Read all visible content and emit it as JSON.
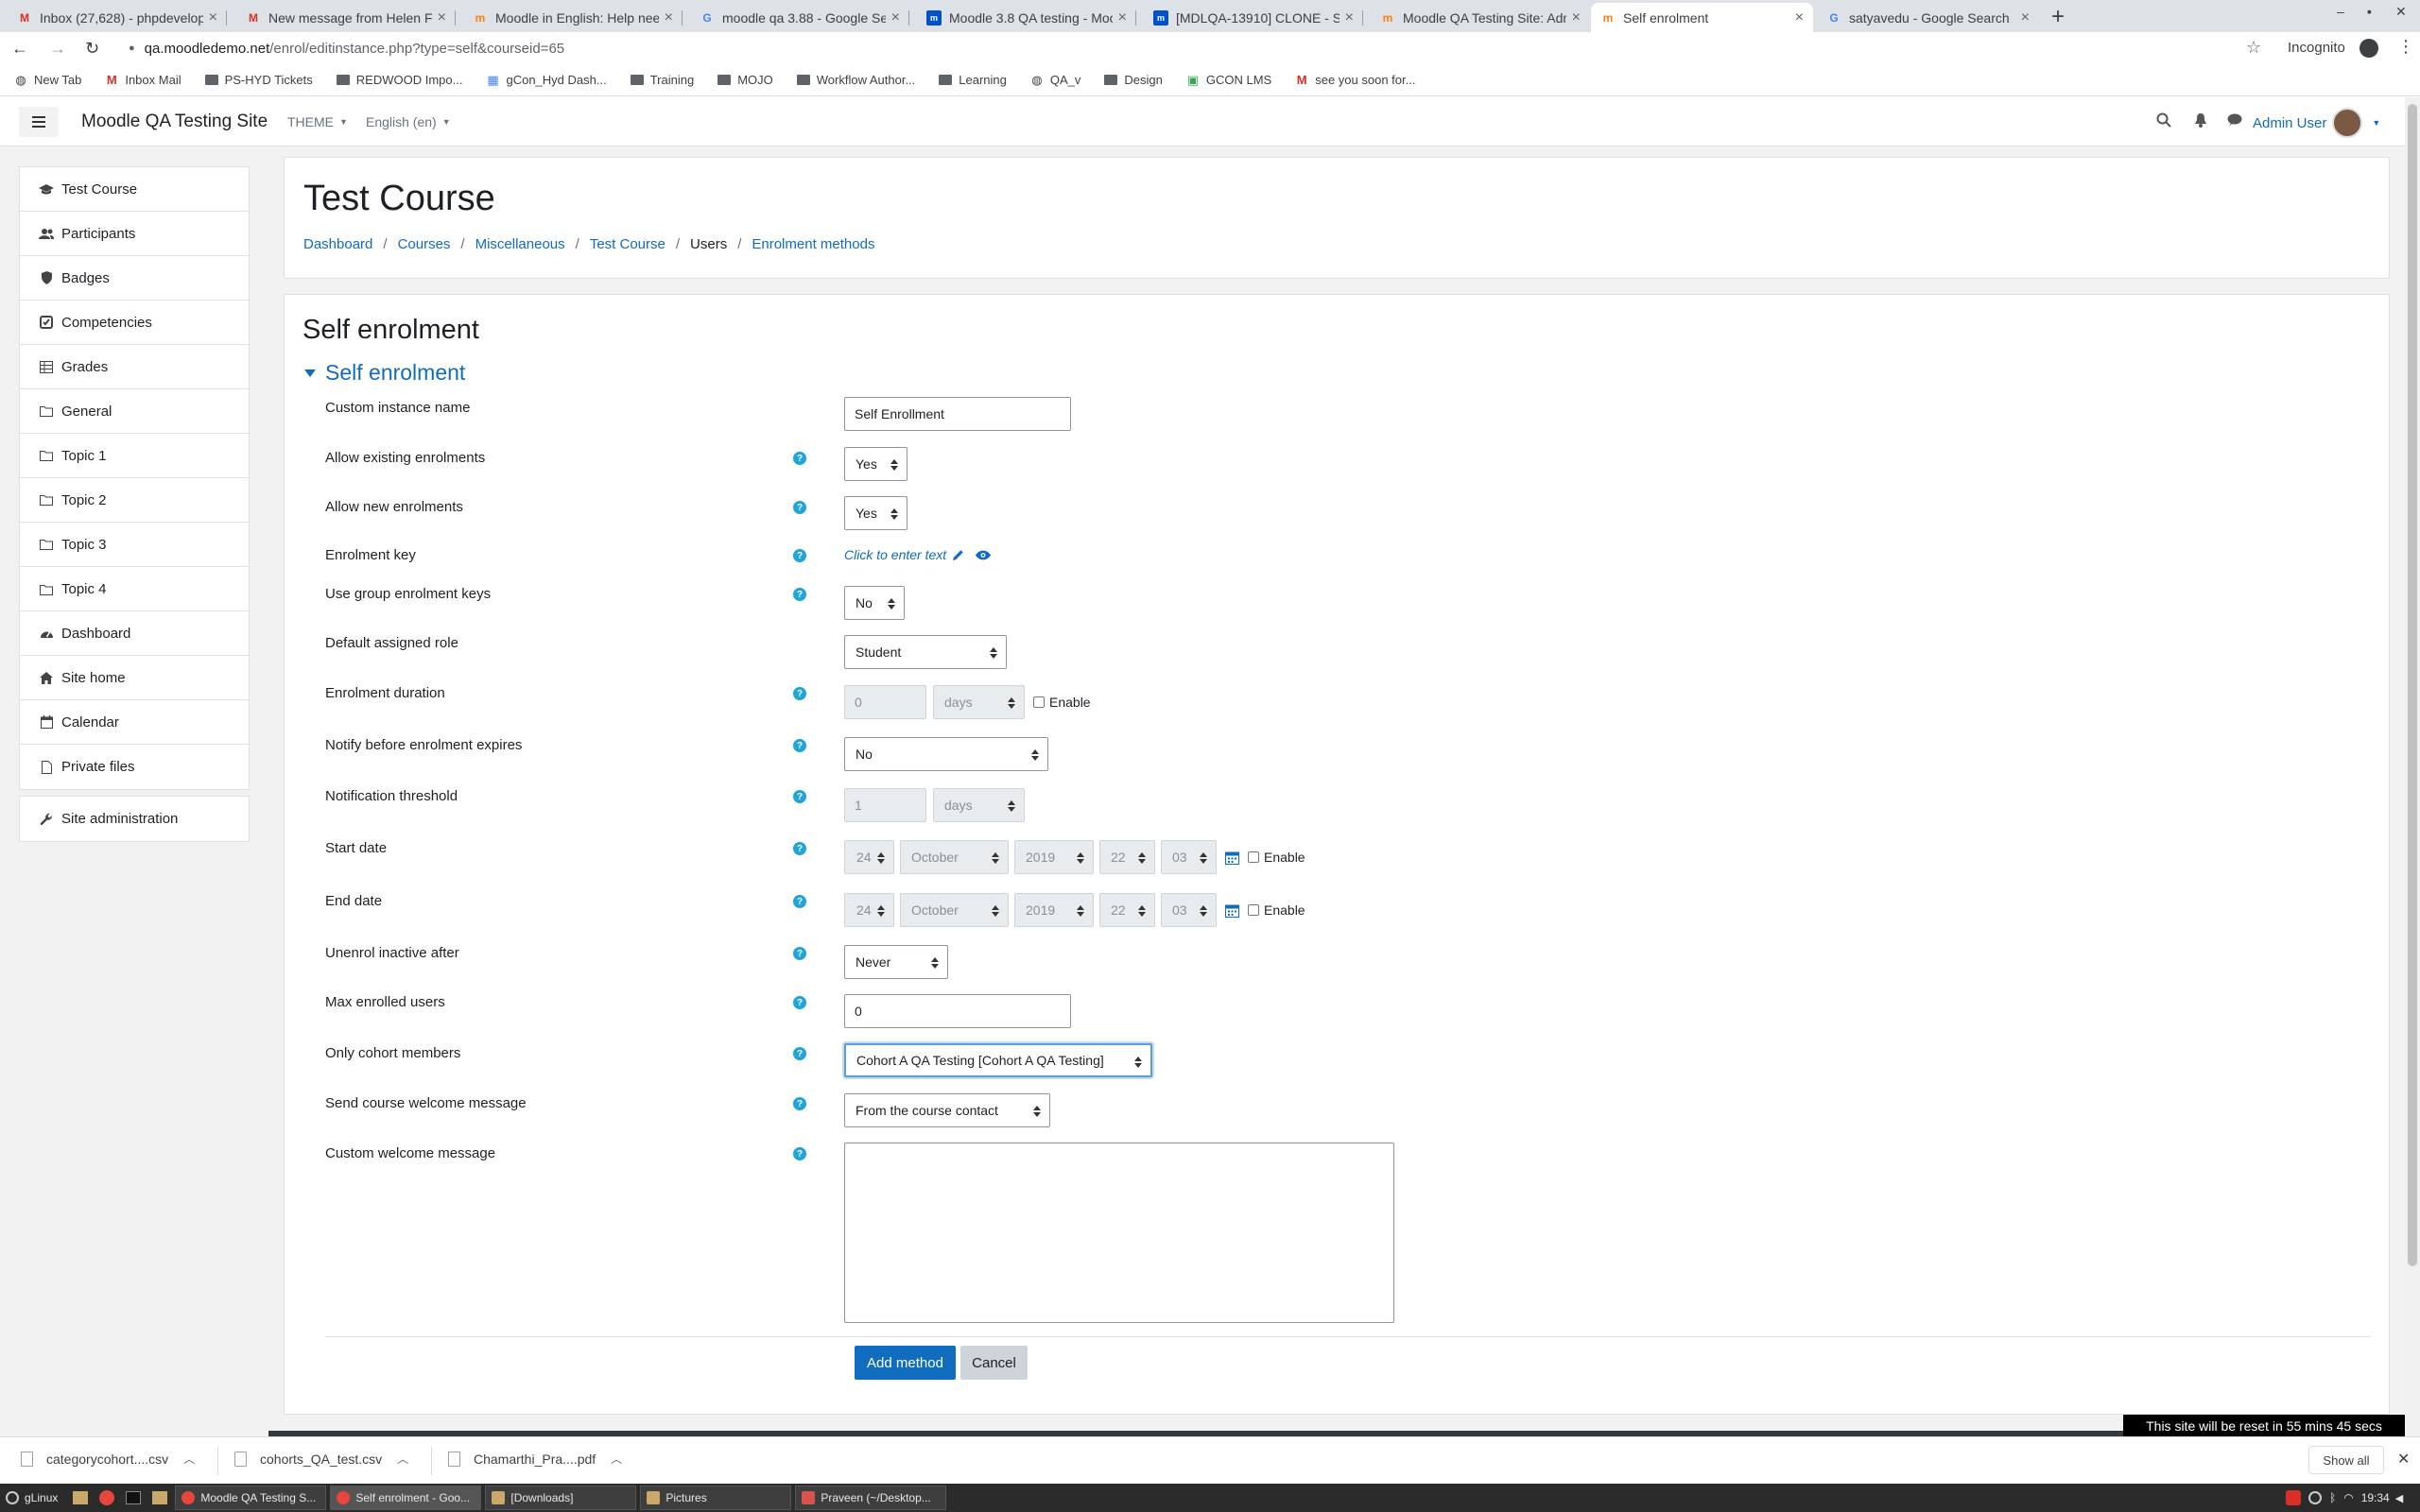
{
  "browser": {
    "tabs": [
      {
        "title": "Inbox (27,628) - phpdevelop",
        "icon": "gmail-icon",
        "active": false
      },
      {
        "title": "New message from Helen Fo",
        "icon": "gmail-icon",
        "active": false
      },
      {
        "title": "Moodle in English: Help need",
        "icon": "moodle-icon",
        "active": false
      },
      {
        "title": "moodle qa 3.88 - Google Sea",
        "icon": "google-icon",
        "active": false
      },
      {
        "title": "Moodle 3.8 QA testing - Moo",
        "icon": "jira-icon",
        "active": false
      },
      {
        "title": "[MDLQA-13910] CLONE - Sel",
        "icon": "jira-icon",
        "active": false
      },
      {
        "title": "Moodle QA Testing Site: Adm",
        "icon": "moodle-icon",
        "active": false
      },
      {
        "title": "Self enrolment",
        "icon": "moodle-icon",
        "active": true
      },
      {
        "title": "satyavedu - Google Search",
        "icon": "google-icon",
        "active": false
      }
    ],
    "url_host": "qa.moodledemo.net",
    "url_path": "/enrol/editinstance.php?type=self&courseid=65",
    "profile_label": "Incognito",
    "bookmarks": [
      {
        "label": "New Tab",
        "icon": "globe-icon"
      },
      {
        "label": "Inbox Mail",
        "icon": "gmail-icon"
      },
      {
        "label": "PS-HYD Tickets",
        "icon": "folder-icon"
      },
      {
        "label": "REDWOOD Impo...",
        "icon": "folder-icon"
      },
      {
        "label": "gCon_Hyd Dash...",
        "icon": "dashboard-icon"
      },
      {
        "label": "Training",
        "icon": "folder-icon"
      },
      {
        "label": "MOJO",
        "icon": "folder-icon"
      },
      {
        "label": "Workflow Author...",
        "icon": "folder-icon"
      },
      {
        "label": "Learning",
        "icon": "folder-icon"
      },
      {
        "label": "QA_v",
        "icon": "globe-icon"
      },
      {
        "label": "Design",
        "icon": "folder-icon"
      },
      {
        "label": "GCON LMS",
        "icon": "lms-icon"
      },
      {
        "label": "see you soon for...",
        "icon": "gmail-icon"
      }
    ]
  },
  "navbar": {
    "site_name": "Moodle QA Testing Site",
    "theme_label": "THEME",
    "language_label": "English (en)",
    "user_name": "Admin User"
  },
  "sidebar": {
    "course_items": [
      {
        "label": "Test Course",
        "icon": "graduation-cap-icon"
      },
      {
        "label": "Participants",
        "icon": "users-icon"
      },
      {
        "label": "Badges",
        "icon": "shield-icon"
      },
      {
        "label": "Competencies",
        "icon": "check-square-icon"
      },
      {
        "label": "Grades",
        "icon": "table-icon"
      },
      {
        "label": "General",
        "icon": "folder-icon"
      },
      {
        "label": "Topic 1",
        "icon": "folder-icon"
      },
      {
        "label": "Topic 2",
        "icon": "folder-icon"
      },
      {
        "label": "Topic 3",
        "icon": "folder-icon"
      },
      {
        "label": "Topic 4",
        "icon": "folder-icon"
      }
    ],
    "site_items": [
      {
        "label": "Dashboard",
        "icon": "dashboard-icon"
      },
      {
        "label": "Site home",
        "icon": "home-icon"
      },
      {
        "label": "Calendar",
        "icon": "calendar-icon"
      },
      {
        "label": "Private files",
        "icon": "file-icon"
      }
    ],
    "admin_items": [
      {
        "label": "Site administration",
        "icon": "wrench-icon"
      }
    ]
  },
  "header": {
    "course_title": "Test Course",
    "breadcrumbs": [
      "Dashboard",
      "Courses",
      "Miscellaneous",
      "Test Course",
      "Users",
      "Enrolment methods"
    ]
  },
  "form": {
    "page_heading": "Self enrolment",
    "section_title": "Self enrolment",
    "fields": {
      "custom_instance_name": {
        "label": "Custom instance name",
        "value": "Self Enrollment"
      },
      "allow_existing": {
        "label": "Allow existing enrolments",
        "value": "Yes"
      },
      "allow_new": {
        "label": "Allow new enrolments",
        "value": "Yes"
      },
      "enrolment_key": {
        "label": "Enrolment key",
        "value": "Click to enter text"
      },
      "group_keys": {
        "label": "Use group enrolment keys",
        "value": "No"
      },
      "default_role": {
        "label": "Default assigned role",
        "value": "Student"
      },
      "duration": {
        "label": "Enrolment duration",
        "value": "0",
        "unit": "days",
        "enable_label": "Enable"
      },
      "notify": {
        "label": "Notify before enrolment expires",
        "value": "No"
      },
      "threshold": {
        "label": "Notification threshold",
        "value": "1",
        "unit": "days"
      },
      "start_date": {
        "label": "Start date",
        "day": "24",
        "month": "October",
        "year": "2019",
        "hour": "22",
        "minute": "03",
        "enable_label": "Enable"
      },
      "end_date": {
        "label": "End date",
        "day": "24",
        "month": "October",
        "year": "2019",
        "hour": "22",
        "minute": "03",
        "enable_label": "Enable"
      },
      "unenrol_inactive": {
        "label": "Unenrol inactive after",
        "value": "Never"
      },
      "max_users": {
        "label": "Max enrolled users",
        "value": "0"
      },
      "cohort": {
        "label": "Only cohort members",
        "value": "Cohort A QA Testing [Cohort A QA Testing]"
      },
      "welcome": {
        "label": "Send course welcome message",
        "value": "From the course contact"
      },
      "custom_welcome": {
        "label": "Custom welcome message",
        "value": ""
      }
    },
    "submit_label": "Add method",
    "cancel_label": "Cancel"
  },
  "reset_notice": "This site will be reset in 55 mins 45 secs",
  "downloads": {
    "files": [
      "categorycohort....csv",
      "cohorts_QA_test.csv",
      "Chamarthi_Pra....pdf"
    ],
    "show_all_label": "Show all"
  },
  "taskbar": {
    "start_label": "gLinux",
    "apps": [
      "Moodle QA Testing S...",
      "Self enrolment - Goo...",
      "[Downloads]",
      "Pictures",
      "Praveen (~/Desktop..."
    ],
    "clock": "19:34"
  },
  "colors": {
    "link": "#0f6cbf",
    "primary_button": "#0f6cbf",
    "help_icon": "#1fa5d6",
    "page_background": "#f2f2f2"
  }
}
